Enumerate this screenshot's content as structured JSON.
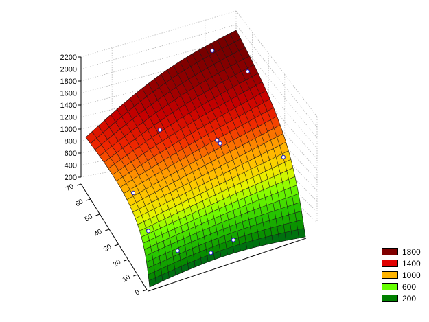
{
  "chart_data": {
    "type": "surface",
    "z_ticks": [
      "2200",
      "2000",
      "1800",
      "1600",
      "1400",
      "1200",
      "1000",
      "800",
      "600",
      "400",
      "200"
    ],
    "x_ticks": [
      "70",
      "60",
      "50",
      "40",
      "30",
      "20",
      "10",
      "0"
    ],
    "zlim": [
      200,
      2200
    ],
    "xlim": [
      0,
      70
    ],
    "grid": true,
    "legend_position": "bottom-right",
    "legend": [
      {
        "label": "1800",
        "color": "#800000"
      },
      {
        "label": "1400",
        "color": "#e00000"
      },
      {
        "label": "1000",
        "color": "#ffb400"
      },
      {
        "label": "600",
        "color": "#66ff00"
      },
      {
        "label": "200",
        "color": "#008000"
      }
    ],
    "observed_points_z": [
      2050,
      1980,
      1850,
      1600,
      1450,
      1400,
      1200,
      900,
      650,
      400,
      300
    ]
  }
}
